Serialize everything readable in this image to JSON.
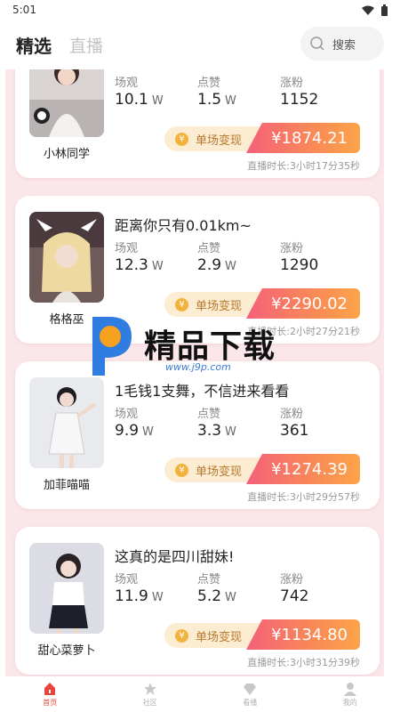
{
  "status_bar": {
    "time": "5:01"
  },
  "header": {
    "tab_selected": "精选",
    "tab_live": "直播",
    "search_placeholder": "搜索"
  },
  "labels": {
    "views": "场观",
    "likes": "点赞",
    "followers": "涨粉",
    "earn_label": "单场变现",
    "coin_symbol": "¥"
  },
  "cards": [
    {
      "title": "",
      "name": "小林同学",
      "views": "10.1",
      "views_unit": "W",
      "likes": "1.5",
      "likes_unit": "W",
      "followers": "1152",
      "amount": "¥1874.21",
      "duration": "直播时长:3小时17分35秒"
    },
    {
      "title": "距离你只有0.01km~",
      "name": "格格巫",
      "views": "12.3",
      "views_unit": "W",
      "likes": "2.9",
      "likes_unit": "W",
      "followers": "1290",
      "amount": "¥2290.02",
      "duration": "直播时长:2小时27分21秒"
    },
    {
      "title": "1毛钱1支舞，不信进来看看",
      "name": "加菲喵喵",
      "views": "9.9",
      "views_unit": "W",
      "likes": "3.3",
      "likes_unit": "W",
      "followers": "361",
      "amount": "¥1274.39",
      "duration": "直播时长:3小时29分57秒"
    },
    {
      "title": "这真的是四川甜妹!",
      "name": "甜心菜萝卜",
      "views": "11.9",
      "views_unit": "W",
      "likes": "5.2",
      "likes_unit": "W",
      "followers": "742",
      "amount": "¥1134.80",
      "duration": "直播时长:3小时31分39秒"
    }
  ],
  "watermark": {
    "text": "精品下载",
    "url": "www.j9p.com"
  },
  "bottom_nav": [
    {
      "label": "首页",
      "icon": "home-icon",
      "active": true
    },
    {
      "label": "社区",
      "icon": "star-icon",
      "active": false
    },
    {
      "label": "看播",
      "icon": "diamond-icon",
      "active": false
    },
    {
      "label": "我的",
      "icon": "person-icon",
      "active": false
    }
  ],
  "colors": {
    "accent": "#e8453c",
    "earn_gradient_start": "#f5607a",
    "earn_gradient_end": "#fca44a",
    "card_bg_pink": "#fbe7ea"
  }
}
